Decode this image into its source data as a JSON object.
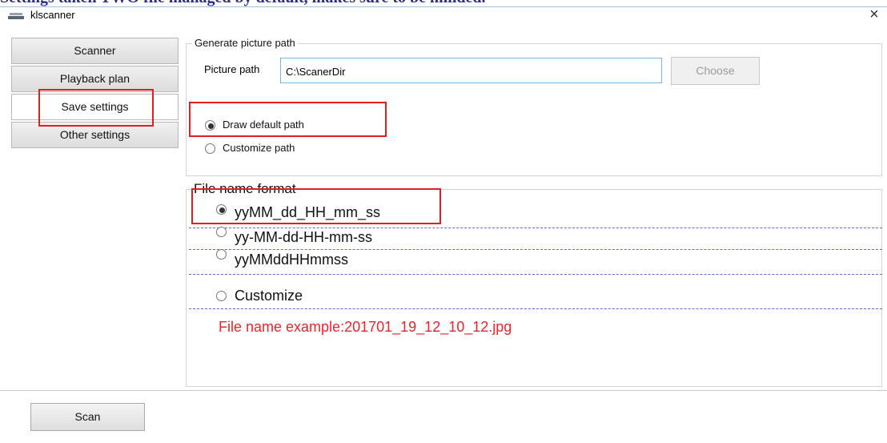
{
  "caption": {
    "text": "Settings taken TWO file managed by default, makes sure to be minded."
  },
  "window": {
    "title": "klscanner",
    "close_icon": "close-icon"
  },
  "sidebar": {
    "items": [
      {
        "label": "Scanner"
      },
      {
        "label": "Playback plan"
      },
      {
        "label": "Save settings",
        "active": true
      },
      {
        "label": "Other settings"
      }
    ]
  },
  "picture_group": {
    "legend": "Generate picture path",
    "path_label": "Picture path",
    "path_value": "C:\\ScanerDir",
    "choose_label": "Choose",
    "options": [
      {
        "label": "Draw default path",
        "checked": true
      },
      {
        "label": "Customize path",
        "checked": false
      }
    ]
  },
  "filename_group": {
    "legend": "File name format",
    "options": [
      {
        "label": "yyMM_dd_HH_mm_ss",
        "checked": true
      },
      {
        "label": "yy-MM-dd-HH-mm-ss",
        "checked": false
      },
      {
        "label": "yyMMddHHmmss",
        "checked": false
      },
      {
        "label": "Customize",
        "checked": false
      }
    ],
    "example": "File name example:201701_19_12_10_12.jpg"
  },
  "footer": {
    "scan_label": "Scan"
  },
  "colors": {
    "highlight": "#e02020",
    "example_text": "#e8262d",
    "input_border": "#7ab4de"
  }
}
